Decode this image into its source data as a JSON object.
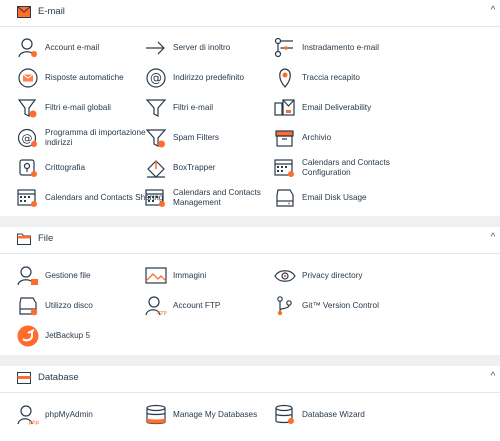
{
  "colors": {
    "accent": "#ff6c2c",
    "icon_stroke": "#293a4a",
    "text": "#293a4a",
    "background": "#eef0f2",
    "panel": "#ffffff"
  },
  "email": {
    "title": "E-mail",
    "items": [
      {
        "label": "Account e-mail",
        "icon": "user-icon"
      },
      {
        "label": "Server di inoltro",
        "icon": "forwarder-arrow-icon"
      },
      {
        "label": "Instradamento e-mail",
        "icon": "routing-icon"
      },
      {
        "label": "Risposte automatiche",
        "icon": "auto-reply-icon"
      },
      {
        "label": "Indirizzo predefinito",
        "icon": "at-sign-icon"
      },
      {
        "label": "Traccia recapito",
        "icon": "location-pin-icon"
      },
      {
        "label": "Filtri e-mail globali",
        "icon": "global-filter-icon"
      },
      {
        "label": "Filtri e-mail",
        "icon": "filter-icon"
      },
      {
        "label": "Email Deliverability",
        "icon": "deliverability-icon"
      },
      {
        "label": "Programma di importazione indirizzi",
        "icon": "address-import-icon"
      },
      {
        "label": "Spam Filters",
        "icon": "spam-filter-icon"
      },
      {
        "label": "Archivio",
        "icon": "archive-box-icon"
      },
      {
        "label": "Crittografia",
        "icon": "encryption-key-icon"
      },
      {
        "label": "BoxTrapper",
        "icon": "boxtrapper-icon"
      },
      {
        "label": "Calendars and Contacts Configuration",
        "icon": "calendar-config-icon"
      },
      {
        "label": "Calendars and Contacts Sharing",
        "icon": "calendar-share-icon"
      },
      {
        "label": "Calendars and Contacts Management",
        "icon": "calendar-manage-icon"
      },
      {
        "label": "Email Disk Usage",
        "icon": "disk-usage-icon"
      }
    ]
  },
  "file": {
    "title": "File",
    "items": [
      {
        "label": "Gestione file",
        "icon": "file-manager-icon"
      },
      {
        "label": "Immagini",
        "icon": "images-icon"
      },
      {
        "label": "Privacy directory",
        "icon": "eye-icon"
      },
      {
        "label": "Utilizzo disco",
        "icon": "disk-icon"
      },
      {
        "label": "Account FTP",
        "icon": "ftp-account-icon"
      },
      {
        "label": "Git™ Version Control",
        "icon": "git-icon"
      },
      {
        "label": "JetBackup 5",
        "icon": "jetbackup-icon"
      }
    ]
  },
  "database": {
    "title": "Database",
    "items": [
      {
        "label": "phpMyAdmin",
        "icon": "phpmyadmin-icon"
      },
      {
        "label": "Manage My Databases",
        "icon": "database-icon"
      },
      {
        "label": "Database Wizard",
        "icon": "database-wizard-icon"
      }
    ]
  }
}
